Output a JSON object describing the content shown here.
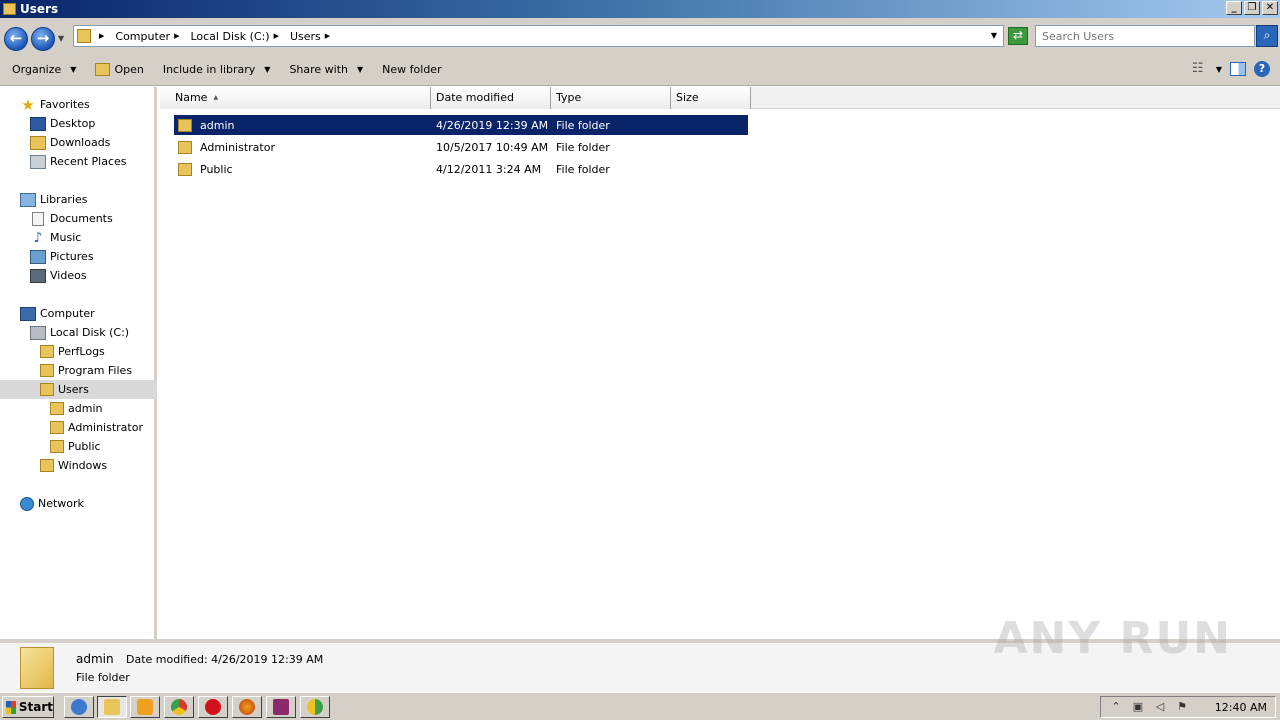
{
  "window": {
    "title": "Users",
    "minimize": "_",
    "restore": "❐",
    "close": "✕"
  },
  "address": {
    "crumbs": [
      "Computer",
      "Local Disk (C:)",
      "Users"
    ],
    "search_placeholder": "Search Users"
  },
  "toolbar": {
    "organize": "Organize",
    "open": "Open",
    "include_in_library": "Include in library",
    "share_with": "Share with",
    "new_folder": "New folder"
  },
  "nav": {
    "favorites": "Favorites",
    "desktop": "Desktop",
    "downloads": "Downloads",
    "recent_places": "Recent Places",
    "libraries": "Libraries",
    "documents": "Documents",
    "music": "Music",
    "pictures": "Pictures",
    "videos": "Videos",
    "computer": "Computer",
    "local_disk": "Local Disk (C:)",
    "perflogs": "PerfLogs",
    "program_files": "Program Files",
    "users": "Users",
    "admin": "admin",
    "administrator": "Administrator",
    "public": "Public",
    "windows": "Windows",
    "network": "Network"
  },
  "columns": {
    "name": "Name",
    "date": "Date modified",
    "type": "Type",
    "size": "Size"
  },
  "files": [
    {
      "name": "admin",
      "date": "4/26/2019 12:39 AM",
      "type": "File folder",
      "selected": true
    },
    {
      "name": "Administrator",
      "date": "10/5/2017 10:49 AM",
      "type": "File folder",
      "selected": false
    },
    {
      "name": "Public",
      "date": "4/12/2011 3:24 AM",
      "type": "File folder",
      "selected": false
    }
  ],
  "details": {
    "name": "admin",
    "modified": "Date modified: 4/26/2019 12:39 AM",
    "type": "File folder",
    "watermark": "ANY RUN"
  },
  "taskbar": {
    "start": "Start",
    "clock": "12:40 AM",
    "apps": [
      "internet-explorer",
      "windows-explorer",
      "media-player",
      "chrome",
      "opera",
      "firefox",
      "winrar",
      "other-app"
    ]
  },
  "colors": {
    "selection": "#0a246a",
    "chrome": "#d4d0c8"
  }
}
